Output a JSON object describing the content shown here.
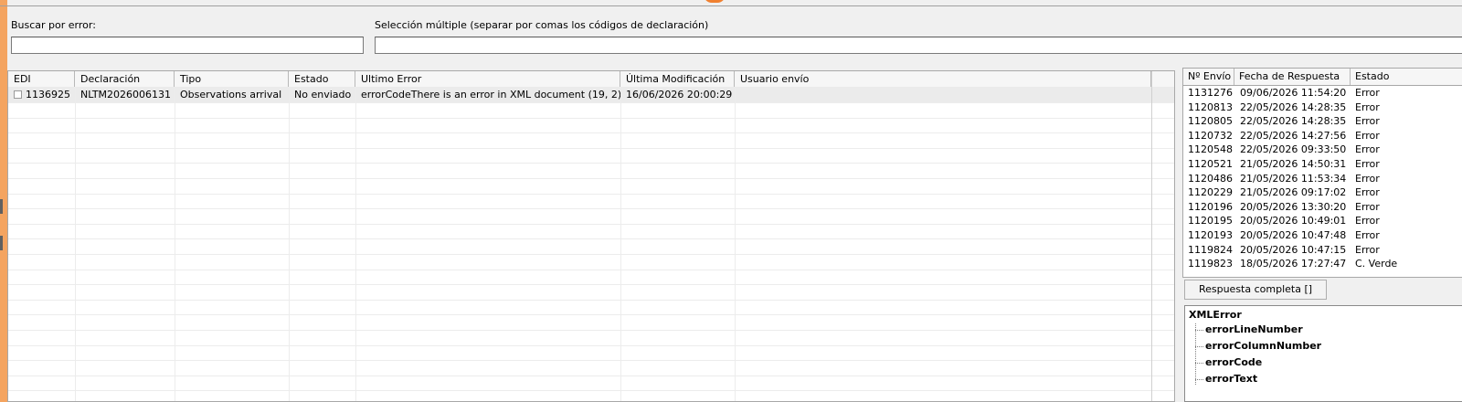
{
  "search": {
    "error_label": "Buscar por error:",
    "multi_label": "Selección múltiple (separar por comas los códigos de declaración)",
    "error_value": "",
    "multi_value": ""
  },
  "grid": {
    "columns": [
      "EDI",
      "Declaración",
      "Tipo",
      "Estado",
      "Ultimo Error",
      "Última Modificación",
      "Usuario envío"
    ],
    "rows": [
      {
        "edi": "1136925",
        "declaracion": "NLTM2026006131",
        "tipo": "Observations arrival",
        "estado": "No enviado",
        "ultimo_error": "errorCodeThere is an error in XML document (19, 2).",
        "ultima_modificacion": "16/06/2026 20:00:29",
        "usuario_envio": ""
      }
    ]
  },
  "responses": {
    "columns": [
      "Nº Envío",
      "Fecha de Respuesta",
      "Estado"
    ],
    "rows": [
      {
        "envio": "1131276",
        "fecha": "09/06/2026 11:54:20",
        "estado": "Error"
      },
      {
        "envio": "1120813",
        "fecha": "22/05/2026 14:28:35",
        "estado": "Error"
      },
      {
        "envio": "1120805",
        "fecha": "22/05/2026 14:28:35",
        "estado": "Error"
      },
      {
        "envio": "1120732",
        "fecha": "22/05/2026 14:27:56",
        "estado": "Error"
      },
      {
        "envio": "1120548",
        "fecha": "22/05/2026 09:33:50",
        "estado": "Error"
      },
      {
        "envio": "1120521",
        "fecha": "21/05/2026 14:50:31",
        "estado": "Error"
      },
      {
        "envio": "1120486",
        "fecha": "21/05/2026 11:53:34",
        "estado": "Error"
      },
      {
        "envio": "1120229",
        "fecha": "21/05/2026 09:17:02",
        "estado": "Error"
      },
      {
        "envio": "1120196",
        "fecha": "20/05/2026 13:30:20",
        "estado": "Error"
      },
      {
        "envio": "1120195",
        "fecha": "20/05/2026 10:49:01",
        "estado": "Error"
      },
      {
        "envio": "1120193",
        "fecha": "20/05/2026 10:47:48",
        "estado": "Error"
      },
      {
        "envio": "1119824",
        "fecha": "20/05/2026 10:47:15",
        "estado": "Error"
      },
      {
        "envio": "1119823",
        "fecha": "18/05/2026 17:27:47",
        "estado": "C. Verde"
      }
    ]
  },
  "full_response_button": "Respuesta completa []",
  "xml_tree": {
    "root": "XMLError",
    "children": [
      "errorLineNumber",
      "errorColumnNumber",
      "errorCode",
      "errorText"
    ]
  },
  "colors": {
    "accent_strip": "#f4a460",
    "selected_row": "#ebebeb"
  }
}
